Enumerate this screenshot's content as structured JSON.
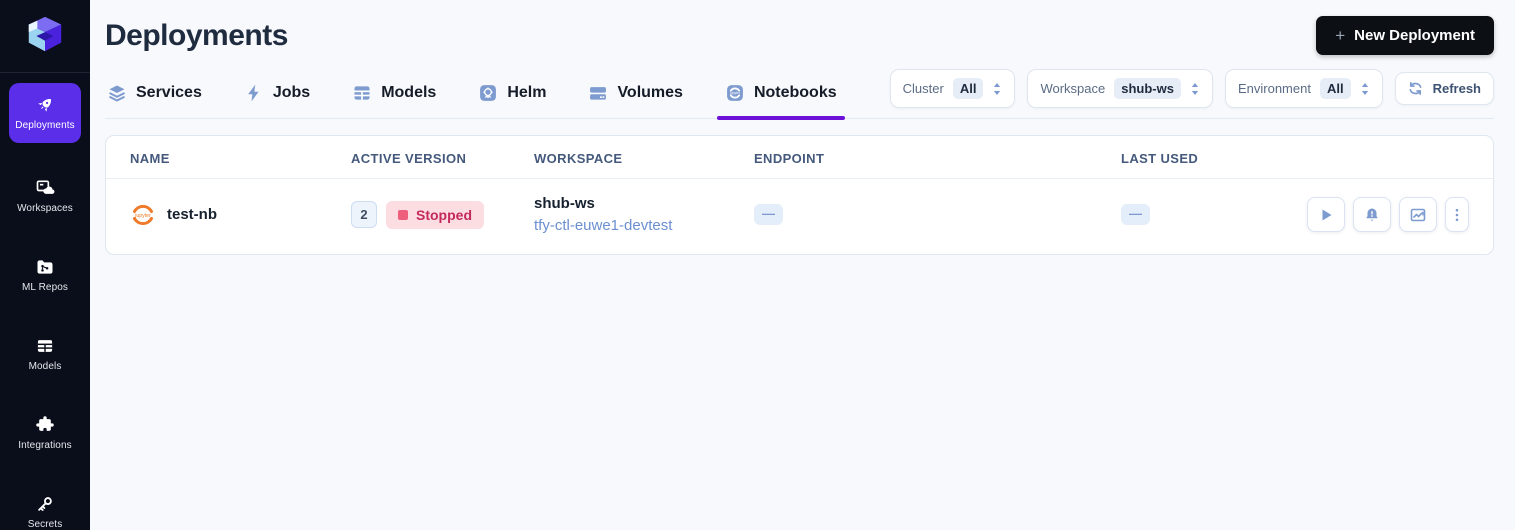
{
  "sidebar": {
    "logo_name": "truefoundry-logo",
    "items": [
      {
        "label": "Deployments",
        "icon": "rocket-icon",
        "active": true
      },
      {
        "label": "Workspaces",
        "icon": "workspaces-icon",
        "active": false
      },
      {
        "label": "ML Repos",
        "icon": "ml-repos-icon",
        "active": false
      },
      {
        "label": "Models",
        "icon": "models-grid-icon",
        "active": false
      },
      {
        "label": "Integrations",
        "icon": "puzzle-icon",
        "active": false
      },
      {
        "label": "Secrets",
        "icon": "key-icon",
        "active": false
      }
    ]
  },
  "header": {
    "title": "Deployments",
    "new_deployment": {
      "label": "New Deployment",
      "plus": "+"
    }
  },
  "tabs": [
    {
      "label": "Services",
      "icon": "layers-icon",
      "active": false
    },
    {
      "label": "Jobs",
      "icon": "bolt-icon",
      "active": false
    },
    {
      "label": "Models",
      "icon": "grid-icon",
      "active": false
    },
    {
      "label": "Helm",
      "icon": "helm-icon",
      "active": false
    },
    {
      "label": "Volumes",
      "icon": "drive-icon",
      "active": false
    },
    {
      "label": "Notebooks",
      "icon": "jupyter-tab-icon",
      "active": true
    }
  ],
  "filters": {
    "cluster": {
      "label": "Cluster",
      "value": "All"
    },
    "workspace": {
      "label": "Workspace",
      "value": "shub-ws"
    },
    "environment": {
      "label": "Environment",
      "value": "All"
    },
    "refresh": {
      "label": "Refresh"
    }
  },
  "table": {
    "columns": {
      "name": "NAME",
      "active_version": "ACTIVE VERSION",
      "workspace": "WORKSPACE",
      "endpoint": "ENDPOINT",
      "last_used": "LAST USED"
    },
    "rows": [
      {
        "name": "test-nb",
        "icon": "jupyter-icon",
        "active_version": "2",
        "status": "Stopped",
        "workspace_name": "shub-ws",
        "workspace_cluster": "tfy-ctl-euwe1-devtest",
        "endpoint": "—",
        "last_used": "—",
        "actions": [
          "start-button",
          "alerts-button",
          "metrics-button",
          "more-options-button"
        ]
      }
    ]
  },
  "colors": {
    "sidebar_bg": "#0a0e1b",
    "accent_purple": "#5b2ee9",
    "tab_underline": "#6d11d9",
    "icon_steel_blue": "#7e9bd0",
    "link_blue": "#6b8fd0",
    "status_stopped_bg": "#fbdde2",
    "status_stopped_text": "#c5295b",
    "button_black": "#0c1015"
  }
}
